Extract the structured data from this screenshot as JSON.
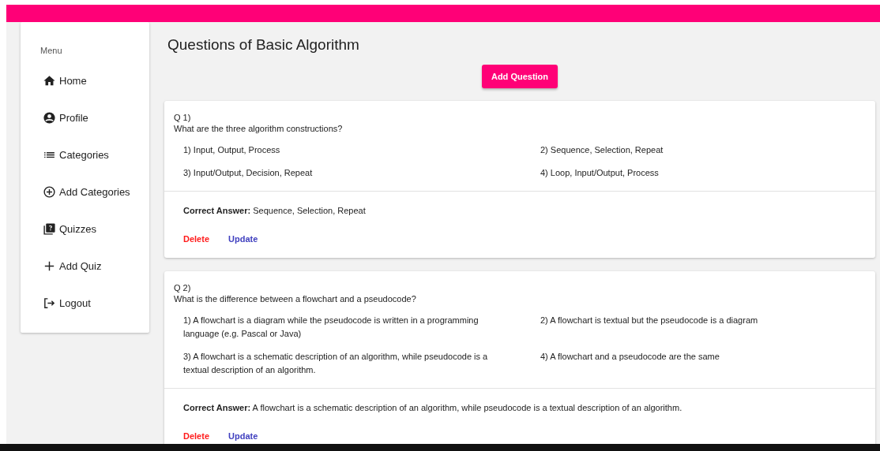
{
  "sidebar": {
    "heading": "Menu",
    "items": [
      {
        "label": "Home",
        "kind": "home"
      },
      {
        "label": "Profile",
        "kind": "profile"
      },
      {
        "label": "Categories",
        "kind": "list"
      },
      {
        "label": "Add Categories",
        "kind": "addcircle"
      },
      {
        "label": "Quizzes",
        "kind": "quiz"
      },
      {
        "label": "Add Quiz",
        "kind": "plus"
      },
      {
        "label": "Logout",
        "kind": "logout"
      }
    ]
  },
  "page": {
    "title": "Questions of Basic Algorithm",
    "add_button": "Add Question"
  },
  "questions": [
    {
      "number": "Q 1)",
      "text": "What are the three algorithm constructions?",
      "options": [
        "1) Input, Output, Process",
        "2) Sequence, Selection, Repeat",
        "3) Input/Output, Decision, Repeat",
        "4) Loop, Input/Output, Process"
      ],
      "answer": "**Correct Answer:** Sequence, Selection, Repeat",
      "delete": "Delete",
      "update": "Update"
    },
    {
      "number": "Q 2)",
      "text": "What is the difference between a flowchart and a pseudocode?",
      "options": [
        "1) A flowchart is a diagram while the pseudocode is written in a programming language (e.g. Pascal or Java)",
        "2) A flowchart is textual but the pseudocode is a diagram",
        "3) A flowchart is a schematic description of an algorithm, while pseudocode is a textual description of an algorithm.",
        "4) A flowchart and a pseudocode are the same"
      ],
      "answer": "**Correct Answer:** A flowchart is a schematic description of an algorithm, while pseudocode is a textual description of an algorithm.",
      "delete": "Delete",
      "update": "Update"
    }
  ]
}
